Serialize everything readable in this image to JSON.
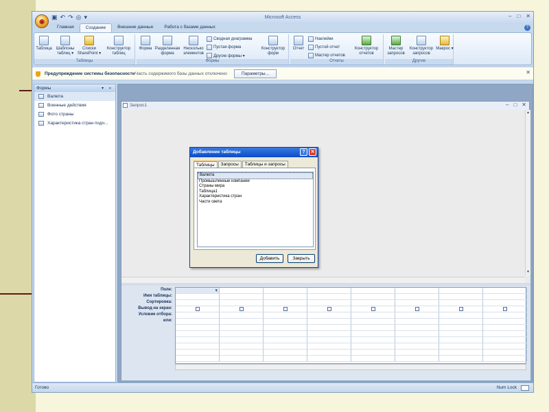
{
  "app": {
    "title": "Microsoft Access",
    "office_button_glyph": "◉",
    "qat_icons": [
      "save-icon",
      "undo-icon",
      "redo-icon",
      "help-icon",
      "dropdown-icon"
    ],
    "window_controls": [
      "–",
      "□",
      "✕"
    ]
  },
  "ribbon": {
    "tabs": [
      {
        "label": "Главная",
        "active": false
      },
      {
        "label": "Создание",
        "active": true
      },
      {
        "label": "Внешние данные",
        "active": false
      },
      {
        "label": "Работа с базами данных",
        "active": false
      }
    ],
    "groups": {
      "tables": {
        "label": "Таблицы",
        "buttons": [
          "Таблица",
          "Шаблоны таблиц ▾",
          "Списки SharePoint ▾",
          "Конструктор таблиц"
        ]
      },
      "forms": {
        "label": "Формы",
        "buttons": [
          "Форма",
          "Разделенная форма",
          "Несколько элементов"
        ],
        "small_buttons": [
          "Сводная диаграмма",
          "Пустая форма",
          "Другие формы ▾"
        ],
        "designer": "Конструктор форм"
      },
      "reports": {
        "label": "Отчеты",
        "report_button": "Отчет",
        "small_buttons": [
          "Наклейки",
          "Пустой отчет",
          "Мастер отчетов"
        ],
        "designer": "Конструктор отчетов"
      },
      "other": {
        "label": "Другие",
        "buttons": [
          "Мастер запросов",
          "Конструктор запросов",
          "Макрос ▾"
        ]
      }
    }
  },
  "security_bar": {
    "title": "Предупреждение системы безопасности",
    "message": "Часть содержимого базы данных отключено",
    "button": "Параметры...",
    "close": "✕"
  },
  "nav_pane": {
    "header": "Формы",
    "header_controls": "▾ «",
    "items": [
      {
        "label": "Валюта",
        "selected": true
      },
      {
        "label": "Военные действия",
        "selected": false
      },
      {
        "label": "Фото страны",
        "selected": false
      },
      {
        "label": "Характеристика стран подч...",
        "selected": false
      }
    ]
  },
  "query_window": {
    "title": "Запрос1",
    "controls": [
      "–",
      "□",
      "✕"
    ],
    "row_labels": [
      "Поле:",
      "Имя таблицы:",
      "Сортировка:",
      "Вывод на экран:",
      "Условие отбора:",
      "или:"
    ],
    "column_count": 8,
    "show_checked": [
      false,
      false,
      false,
      false,
      false,
      false,
      false,
      false
    ]
  },
  "dialog": {
    "title": "Добавление таблицы",
    "help_glyph": "?",
    "close_glyph": "✕",
    "tabs": [
      {
        "label": "Таблицы",
        "active": true
      },
      {
        "label": "Запросы",
        "active": false
      },
      {
        "label": "Таблицы и запросы",
        "active": false
      }
    ],
    "list_items": [
      {
        "label": "Валюта",
        "selected": true
      },
      {
        "label": "Промышленные компании",
        "selected": false
      },
      {
        "label": "Страны мира",
        "selected": false
      },
      {
        "label": "Таблица1",
        "selected": false
      },
      {
        "label": "Характеристика стран",
        "selected": false
      },
      {
        "label": "Части света",
        "selected": false
      }
    ],
    "add_button": "Добавить",
    "close_button": "Закрыть"
  },
  "status_bar": {
    "left": "Готово",
    "right": "Num Lock"
  },
  "colors": {
    "ribbon_blue": "#c6d8ec",
    "dialog_titlebar": "#0a4cc8",
    "slide_background": "#f7f5dc",
    "slide_strip": "#ddd8a8"
  }
}
